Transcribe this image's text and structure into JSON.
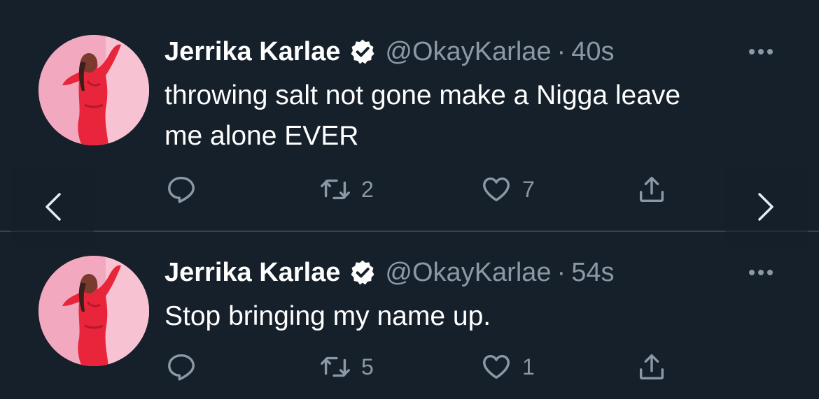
{
  "colors": {
    "background": "#15202b",
    "text_primary": "#ffffff",
    "text_secondary": "#8b98a5",
    "divider": "#38444d",
    "verified_badge": "#ffffff"
  },
  "tweets": [
    {
      "display_name": "Jerrika Karlae",
      "handle": "@OkayKarlae",
      "separator": "·",
      "timestamp": "40s",
      "text_line_1": "throwing salt not gone make a Nigga leave",
      "text_line_2": "me alone EVER",
      "retweet_count": "2",
      "like_count": "7",
      "icons": [
        "reply-icon",
        "retweet-icon",
        "like-icon",
        "share-icon",
        "more-icon",
        "verified-icon"
      ]
    },
    {
      "display_name": "Jerrika Karlae",
      "handle": "@OkayKarlae",
      "separator": "·",
      "timestamp": "54s",
      "text_line_1": "Stop bringing my name up.",
      "retweet_count": "5",
      "like_count": "1",
      "icons": [
        "reply-icon",
        "retweet-icon",
        "like-icon",
        "share-icon",
        "more-icon",
        "verified-icon"
      ]
    }
  ],
  "navigation": {
    "prev_icon": "chevron-left-icon",
    "next_icon": "chevron-right-icon"
  }
}
